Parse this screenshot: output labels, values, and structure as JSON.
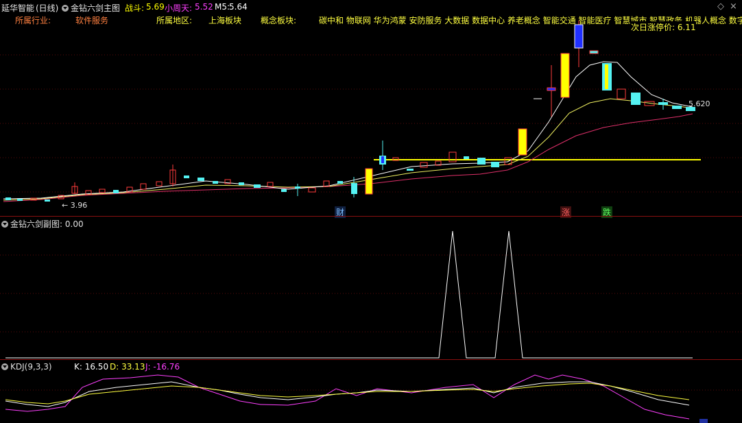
{
  "header": {
    "stock_name": "延华智能",
    "period": "(日线)",
    "indicator": "金钻六剑主图",
    "zhandou_label": "战斗:",
    "zhandou_value": "5.69",
    "xiaozhoutian_label": "小周天:",
    "xiaozhoutian_value": "5.52",
    "m5_label": "M5:",
    "m5_value": "5.64"
  },
  "info": {
    "industry_label": "所属行业:",
    "industry_value": "软件服务",
    "region_label": "所属地区:",
    "region_value": "上海板块",
    "concept_label": "概念板块:",
    "concept_value": "碳中和 物联网 华为鸿蒙 安防服务 大数据 数据中心 养老概念 智能交通 智能医疗 智慧城市 智慧政务 机器人概念 数字孪",
    "limit_price": "次日涨停价: 6.11"
  },
  "price_labels": {
    "low": "3.96",
    "current": "5.620"
  },
  "markers": {
    "cai": "财",
    "zhang": "涨",
    "die": "跌"
  },
  "panel2": {
    "title": "金钻六剑副图",
    "value": ": 0.00"
  },
  "panel3": {
    "title": "KDJ(9,3,3)",
    "k": "K: 16.50",
    "d": "D: 33.13",
    "j": "J: -16.76"
  },
  "colors": {
    "up": "#ff3b3b",
    "down": "#54f2f2",
    "yellow": "#ffff00",
    "ma_white": "#ffffff",
    "ma_yellow": "#f0f060",
    "ma_pink": "#e0306a",
    "k_line": "#ffffff",
    "d_line": "#ffff40",
    "j_line": "#ff40ff",
    "separator": "#8a1010"
  }
}
